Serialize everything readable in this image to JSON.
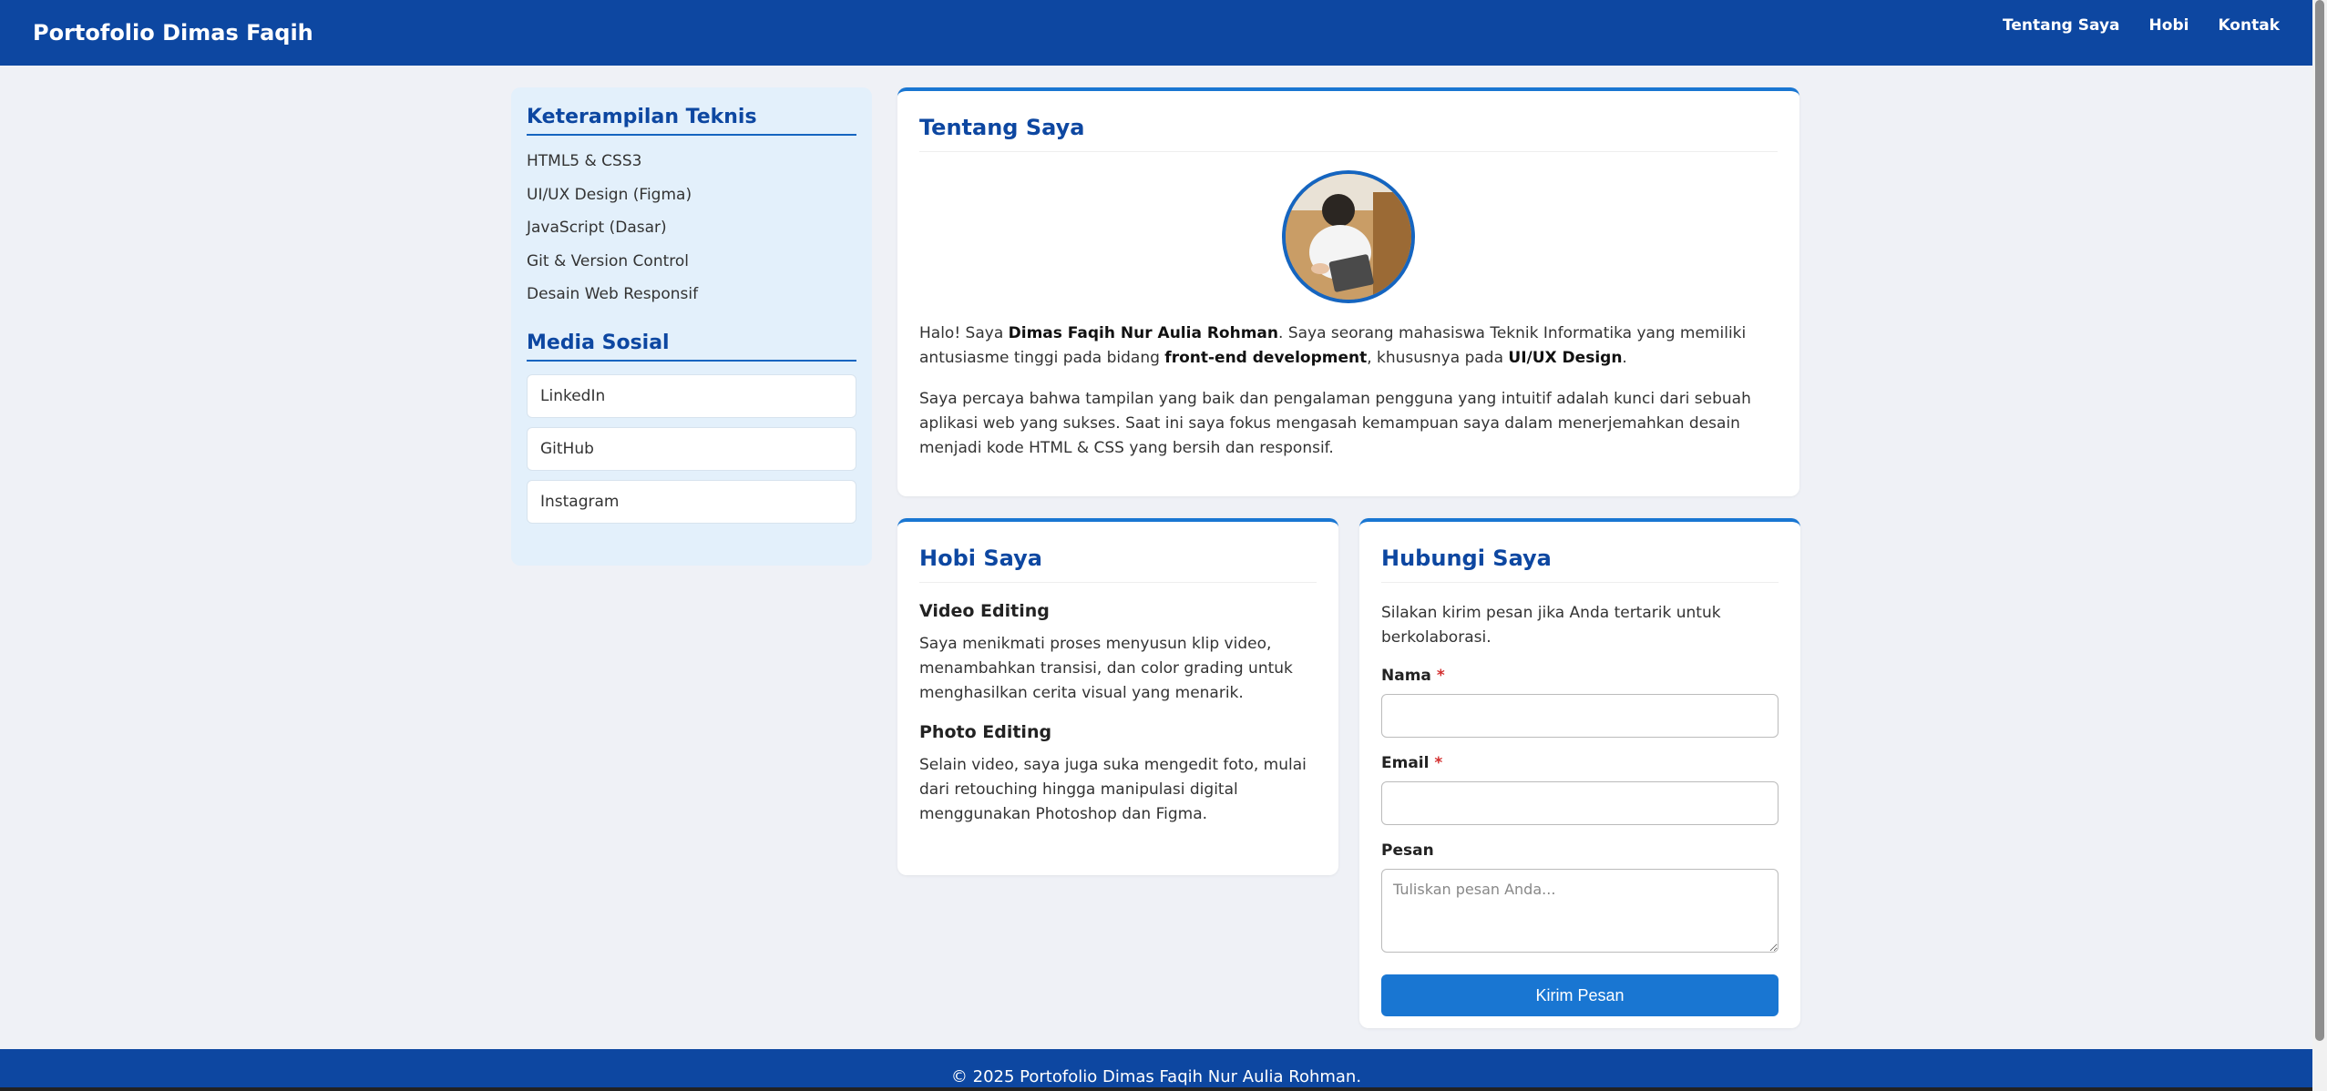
{
  "header": {
    "brand": "Portofolio Dimas Faqih",
    "nav": [
      "Tentang Saya",
      "Hobi",
      "Kontak"
    ]
  },
  "sidebar": {
    "skills_title": "Keterampilan Teknis",
    "skills": [
      "HTML5 & CSS3",
      "UI/UX Design (Figma)",
      "JavaScript (Dasar)",
      "Git & Version Control",
      "Desain Web Responsif"
    ],
    "social_title": "Media Sosial",
    "social": [
      "LinkedIn",
      "GitHub",
      "Instagram"
    ]
  },
  "about": {
    "title": "Tentang Saya",
    "p1": {
      "a": "Halo! Saya ",
      "name": "Dimas Faqih Nur Aulia Rohman",
      "b": ". Saya seorang mahasiswa Teknik Informatika yang memiliki antusiasme tinggi pada bidang ",
      "field1": "front-end development",
      "c": ", khususnya pada ",
      "field2": "UI/UX Design",
      "d": "."
    },
    "p2": "Saya percaya bahwa tampilan yang baik dan pengalaman pengguna yang intuitif adalah kunci dari sebuah aplikasi web yang sukses. Saat ini saya fokus mengasah kemampuan saya dalam menerjemahkan desain menjadi kode HTML & CSS yang bersih dan responsif."
  },
  "hobby": {
    "title": "Hobi Saya",
    "items": [
      {
        "title": "Video Editing",
        "text": "Saya menikmati proses menyusun klip video, menambahkan transisi, dan color grading untuk menghasilkan cerita visual yang menarik."
      },
      {
        "title": "Photo Editing",
        "text": "Selain video, saya juga suka mengedit foto, mulai dari retouching hingga manipulasi digital menggunakan Photoshop dan Figma."
      }
    ]
  },
  "contact": {
    "title": "Hubungi Saya",
    "intro": "Silakan kirim pesan jika Anda tertarik untuk berkolaborasi.",
    "name_label": "Nama",
    "email_label": "Email",
    "message_label": "Pesan",
    "required_mark": "*",
    "name_value": "",
    "email_value": "",
    "message_placeholder": "Tuliskan pesan Anda...",
    "submit_label": "Kirim Pesan"
  },
  "footer": {
    "text": "© 2025 Portofolio Dimas Faqih Nur Aulia Rohman."
  },
  "colors": {
    "primary": "#0d47a1",
    "accent": "#1976d2",
    "sidebar_bg": "#e3f0fb",
    "page_bg": "#eff1f6",
    "required": "#d32f2f"
  }
}
